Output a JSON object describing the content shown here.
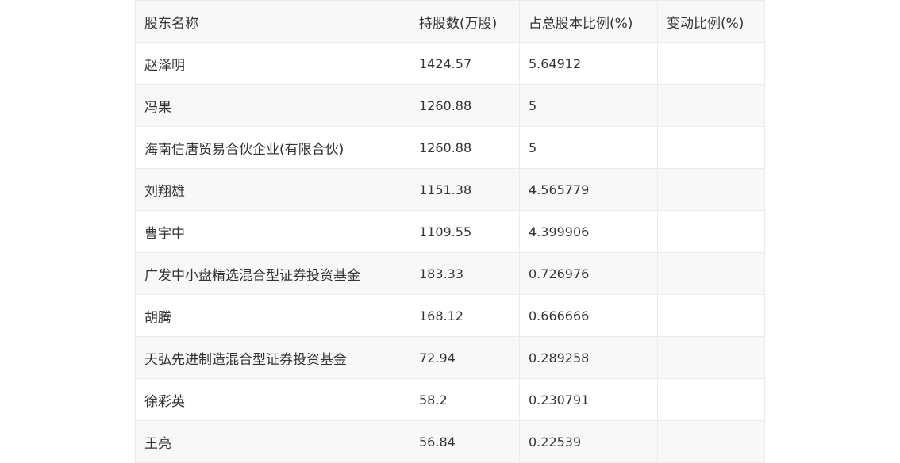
{
  "table": {
    "headers": [
      "股东名称",
      "持股数(万股)",
      "占总股本比例(%)",
      "变动比例(%)"
    ],
    "rows": [
      [
        "赵泽明",
        "1424.57",
        "5.64912",
        ""
      ],
      [
        "冯果",
        "1260.88",
        "5",
        ""
      ],
      [
        "海南信唐贸易合伙企业(有限合伙)",
        "1260.88",
        "5",
        ""
      ],
      [
        "刘翔雄",
        "1151.38",
        "4.565779",
        ""
      ],
      [
        "曹宇中",
        "1109.55",
        "4.399906",
        ""
      ],
      [
        "广发中小盘精选混合型证券投资基金",
        "183.33",
        "0.726976",
        ""
      ],
      [
        "胡腾",
        "168.12",
        "0.666666",
        ""
      ],
      [
        "天弘先进制造混合型证券投资基金",
        "72.94",
        "0.289258",
        ""
      ],
      [
        "徐彩英",
        "58.2",
        "0.230791",
        ""
      ],
      [
        "王亮",
        "56.84",
        "0.22539",
        ""
      ]
    ]
  }
}
